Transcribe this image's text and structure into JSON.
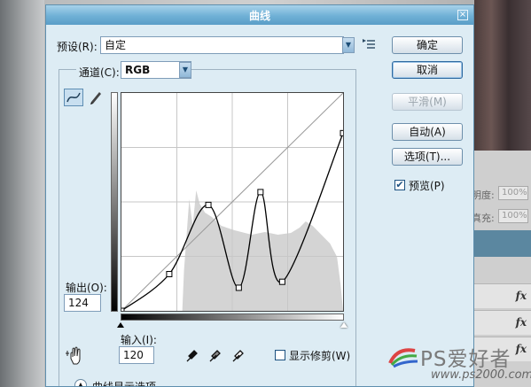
{
  "dialog": {
    "title": "曲线",
    "close_glyph": "×"
  },
  "preset": {
    "label": "预设(R):",
    "value": "自定"
  },
  "channel": {
    "label": "通道(C):",
    "value": "RGB"
  },
  "buttons": {
    "ok": "确定",
    "cancel": "取消",
    "smooth": "平滑(M)",
    "auto": "自动(A)",
    "options": "选项(T)..."
  },
  "preview": {
    "label": "预览(P)",
    "checked": true
  },
  "output": {
    "label": "输出(O):",
    "value": "124"
  },
  "input": {
    "label": "输入(I):",
    "value": "120"
  },
  "show_clipping": {
    "label": "显示修剪(W)",
    "checked": false
  },
  "curve_display_options": {
    "label": "曲线显示选项"
  },
  "curve_points": [
    {
      "input": 0,
      "output": 0
    },
    {
      "input": 55,
      "output": 43
    },
    {
      "input": 100,
      "output": 124
    },
    {
      "input": 135,
      "output": 27
    },
    {
      "input": 160,
      "output": 139
    },
    {
      "input": 185,
      "output": 34
    },
    {
      "input": 255,
      "output": 208
    }
  ],
  "layers_panel": {
    "opacity_label": "明度:",
    "opacity_value": "100%",
    "fill_label": "真充:",
    "fill_value": "100%",
    "fx_label": "fx"
  },
  "watermark": {
    "logo_text": "PS爱好者",
    "url": "www.ps2000.com"
  },
  "icons": [
    "curve-tool-icon",
    "pencil-tool-icon",
    "preset-menu-icon",
    "hand-target-icon",
    "black-eyedropper-icon",
    "gray-eyedropper-icon",
    "white-eyedropper-icon",
    "collapse-arrow-icon"
  ]
}
